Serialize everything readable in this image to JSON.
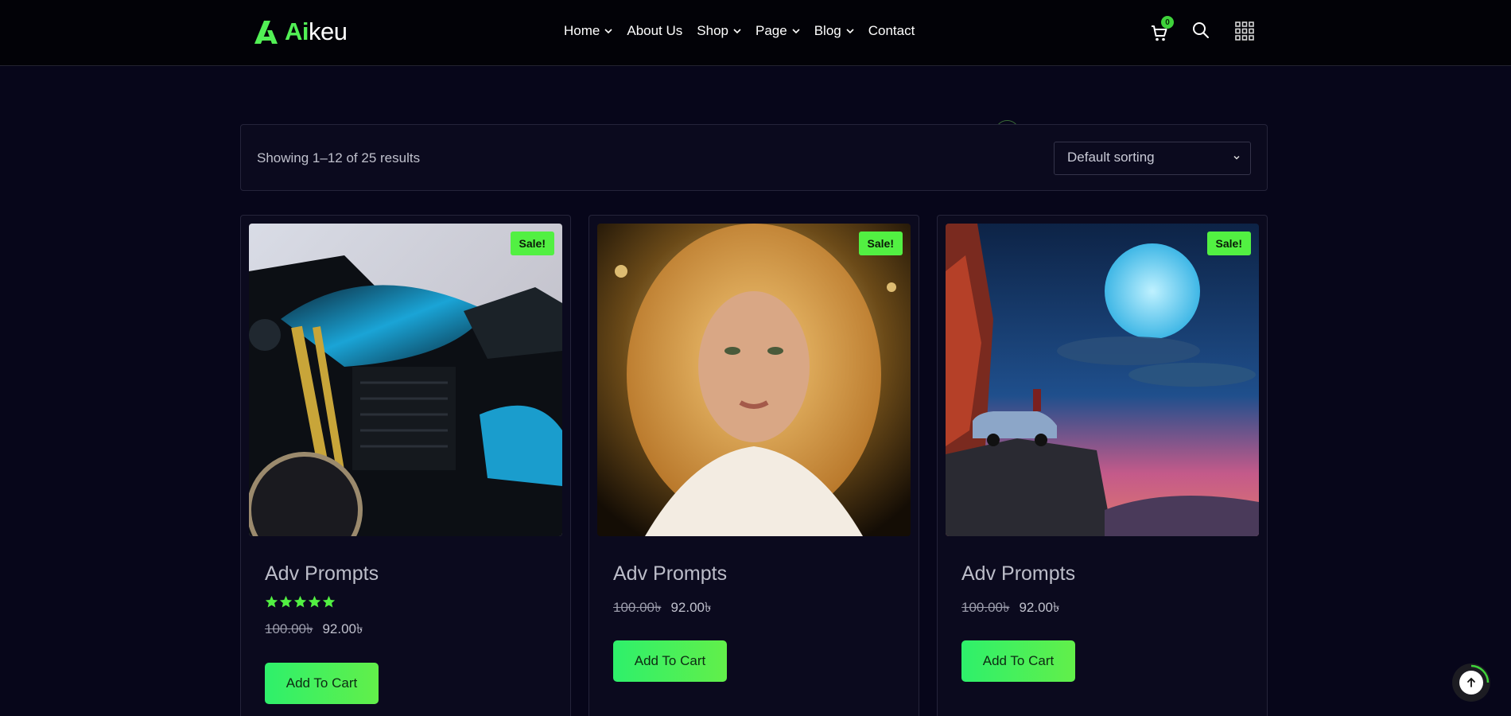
{
  "brand": {
    "logo_green": "Ai",
    "logo_white": "keu"
  },
  "nav": [
    {
      "label": "Home",
      "dropdown": true
    },
    {
      "label": "About Us",
      "dropdown": false
    },
    {
      "label": "Shop",
      "dropdown": true
    },
    {
      "label": "Page",
      "dropdown": true
    },
    {
      "label": "Blog",
      "dropdown": true
    },
    {
      "label": "Contact",
      "dropdown": false
    }
  ],
  "header": {
    "cart_count": "0",
    "icons": [
      "cart-icon",
      "search-icon",
      "grid-menu-icon"
    ]
  },
  "shop": {
    "result_count": "Showing 1–12 of 25 results",
    "sorting": "Default sorting"
  },
  "products": [
    {
      "title": "Adv Prompts",
      "badge": "Sale!",
      "old_price": "100.00৳",
      "new_price": "92.00৳",
      "rating": 5,
      "button": "Add To Cart"
    },
    {
      "title": "Adv Prompts",
      "badge": "Sale!",
      "old_price": "100.00৳",
      "new_price": "92.00৳",
      "button": "Add To Cart"
    },
    {
      "title": "Adv Prompts",
      "badge": "Sale!",
      "old_price": "100.00৳",
      "new_price": "92.00৳",
      "button": "Add To Cart"
    }
  ],
  "colors": {
    "accent": "#52f042",
    "background": "#07061a",
    "header": "#020207"
  }
}
